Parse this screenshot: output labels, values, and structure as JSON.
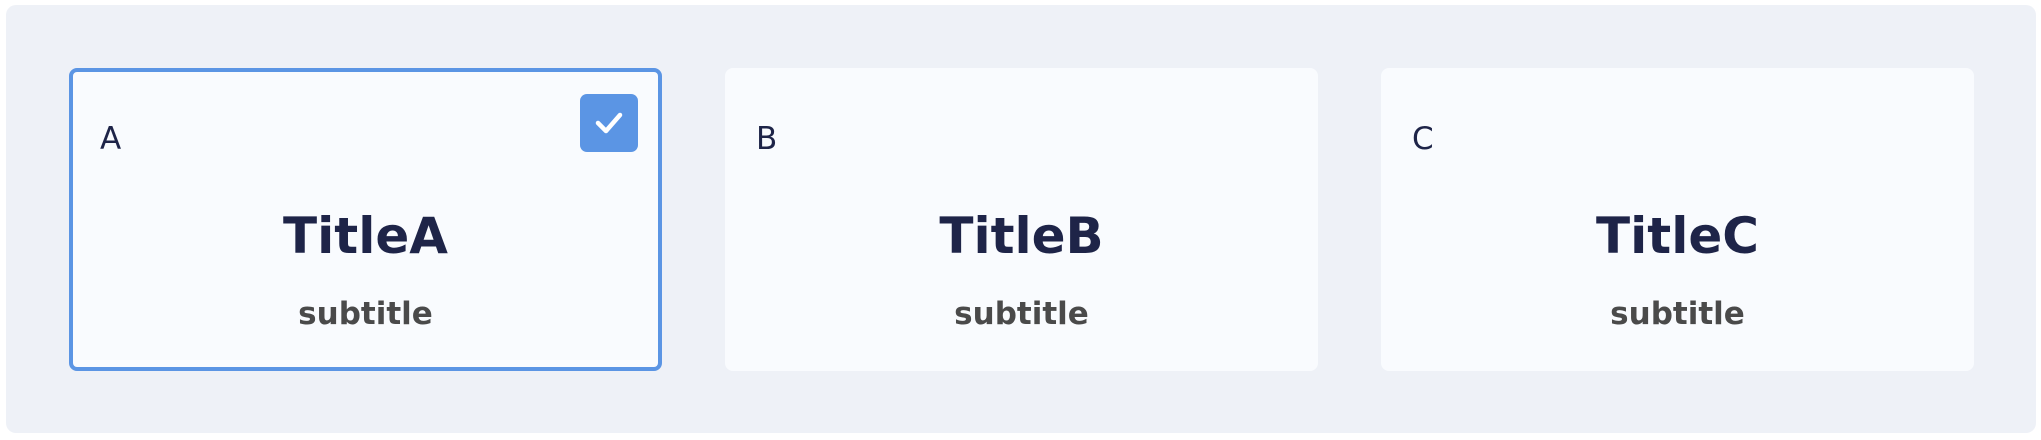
{
  "cards": [
    {
      "letter": "A",
      "title": "TitleA",
      "subtitle": "subtitle",
      "selected": true
    },
    {
      "letter": "B",
      "title": "TitleB",
      "subtitle": "subtitle",
      "selected": false
    },
    {
      "letter": "C",
      "title": "TitleC",
      "subtitle": "subtitle",
      "selected": false
    }
  ],
  "colors": {
    "accent": "#5b95e4",
    "panel_bg": "#eef1f7",
    "card_bg": "#f9fbfe",
    "title_text": "#1e2448",
    "subtitle_text": "#4a4a4a"
  },
  "icons": {
    "selected_indicator": "checkmark-icon"
  }
}
